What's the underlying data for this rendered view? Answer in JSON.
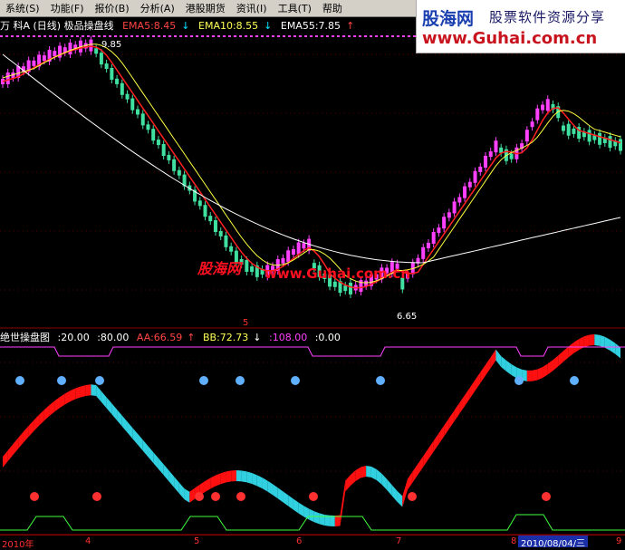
{
  "menubar": {
    "items": [
      "系统(S)",
      "功能(F)",
      "报价(B)",
      "分析(A)",
      "港股期货",
      "资讯(I)",
      "工具(T)",
      "帮助"
    ]
  },
  "banner": {
    "logo": "股海网",
    "slogan": "股票软件资源分享",
    "url": "www.Guhai.com.cn"
  },
  "main_title": {
    "prefix": "万 科A (日线) 极品操盘线",
    "ema5": "EMA5:8.45",
    "ema10": "EMA10:8.55",
    "ema55": "EMA55:7.85"
  },
  "watermark": {
    "brand": "股海网",
    "url": "www.Guhai.com.cn"
  },
  "price_labels": {
    "high": "9.85",
    "low": "6.65"
  },
  "mid_number": "5",
  "sub_title": {
    "name": "绝世操盘图",
    "v1": ":20.00",
    "v2": ":80.00",
    "aa": "AA:66.59",
    "bb": "BB:72.73",
    "v3": ":108.00",
    "v4": ":0.00"
  },
  "axis": {
    "labels": [
      "2010年",
      "4",
      "5",
      "6",
      "7",
      "8",
      "9"
    ],
    "cursor_date": "2010/08/04/三"
  },
  "colors": {
    "up": "#ff40ff",
    "down": "#40e0a0",
    "ema5": "#ff2020",
    "ema10": "#ffff40",
    "ema55": "#ffffff",
    "ribbon_up": "#ff1010",
    "ribbon_down": "#30d0e0"
  }
}
